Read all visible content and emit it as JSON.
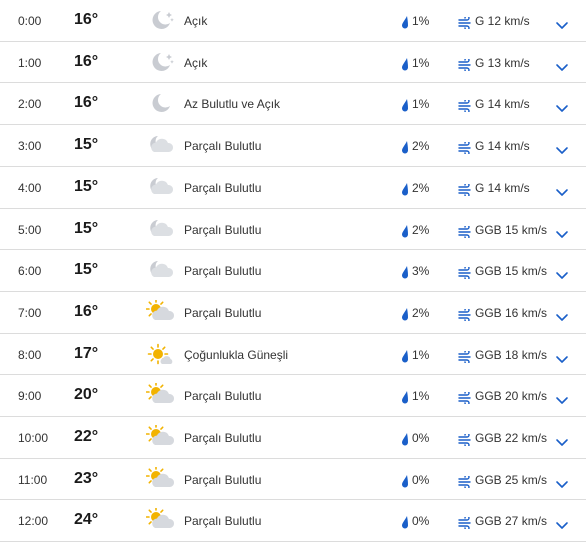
{
  "colors": {
    "accent": "#1a5fc9",
    "divider": "#dcdcdc",
    "moon": "#c9ccd2",
    "cloud": "#c9ccd2",
    "sun": "#f2b300"
  },
  "hours": [
    {
      "time": "0:00",
      "temp": "16°",
      "icon": "clear-night-icon",
      "condition": "Açık",
      "precip": "1%",
      "wind": "G 12 km/s"
    },
    {
      "time": "1:00",
      "temp": "16°",
      "icon": "clear-night-icon",
      "condition": "Açık",
      "precip": "1%",
      "wind": "G 13 km/s"
    },
    {
      "time": "2:00",
      "temp": "16°",
      "icon": "moon-icon",
      "condition": "Az Bulutlu ve Açık",
      "precip": "1%",
      "wind": "G 14 km/s"
    },
    {
      "time": "3:00",
      "temp": "15°",
      "icon": "partly-cloudy-night-icon",
      "condition": "Parçalı Bulutlu",
      "precip": "2%",
      "wind": "G 14 km/s"
    },
    {
      "time": "4:00",
      "temp": "15°",
      "icon": "partly-cloudy-night-icon",
      "condition": "Parçalı Bulutlu",
      "precip": "2%",
      "wind": "G 14 km/s"
    },
    {
      "time": "5:00",
      "temp": "15°",
      "icon": "partly-cloudy-night-icon",
      "condition": "Parçalı Bulutlu",
      "precip": "2%",
      "wind": "GGB 15 km/s"
    },
    {
      "time": "6:00",
      "temp": "15°",
      "icon": "partly-cloudy-night-icon",
      "condition": "Parçalı Bulutlu",
      "precip": "3%",
      "wind": "GGB 15 km/s"
    },
    {
      "time": "7:00",
      "temp": "16°",
      "icon": "partly-cloudy-day-icon",
      "condition": "Parçalı Bulutlu",
      "precip": "2%",
      "wind": "GGB 16 km/s"
    },
    {
      "time": "8:00",
      "temp": "17°",
      "icon": "mostly-sunny-icon",
      "condition": "Çoğunlukla Güneşli",
      "precip": "1%",
      "wind": "GGB 18 km/s"
    },
    {
      "time": "9:00",
      "temp": "20°",
      "icon": "partly-cloudy-day-icon",
      "condition": "Parçalı Bulutlu",
      "precip": "1%",
      "wind": "GGB 20 km/s"
    },
    {
      "time": "10:00",
      "temp": "22°",
      "icon": "partly-cloudy-day-icon",
      "condition": "Parçalı Bulutlu",
      "precip": "0%",
      "wind": "GGB 22 km/s"
    },
    {
      "time": "11:00",
      "temp": "23°",
      "icon": "partly-cloudy-day-icon",
      "condition": "Parçalı Bulutlu",
      "precip": "0%",
      "wind": "GGB 25 km/s"
    },
    {
      "time": "12:00",
      "temp": "24°",
      "icon": "partly-cloudy-day-icon",
      "condition": "Parçalı Bulutlu",
      "precip": "0%",
      "wind": "GGB 27 km/s"
    }
  ]
}
